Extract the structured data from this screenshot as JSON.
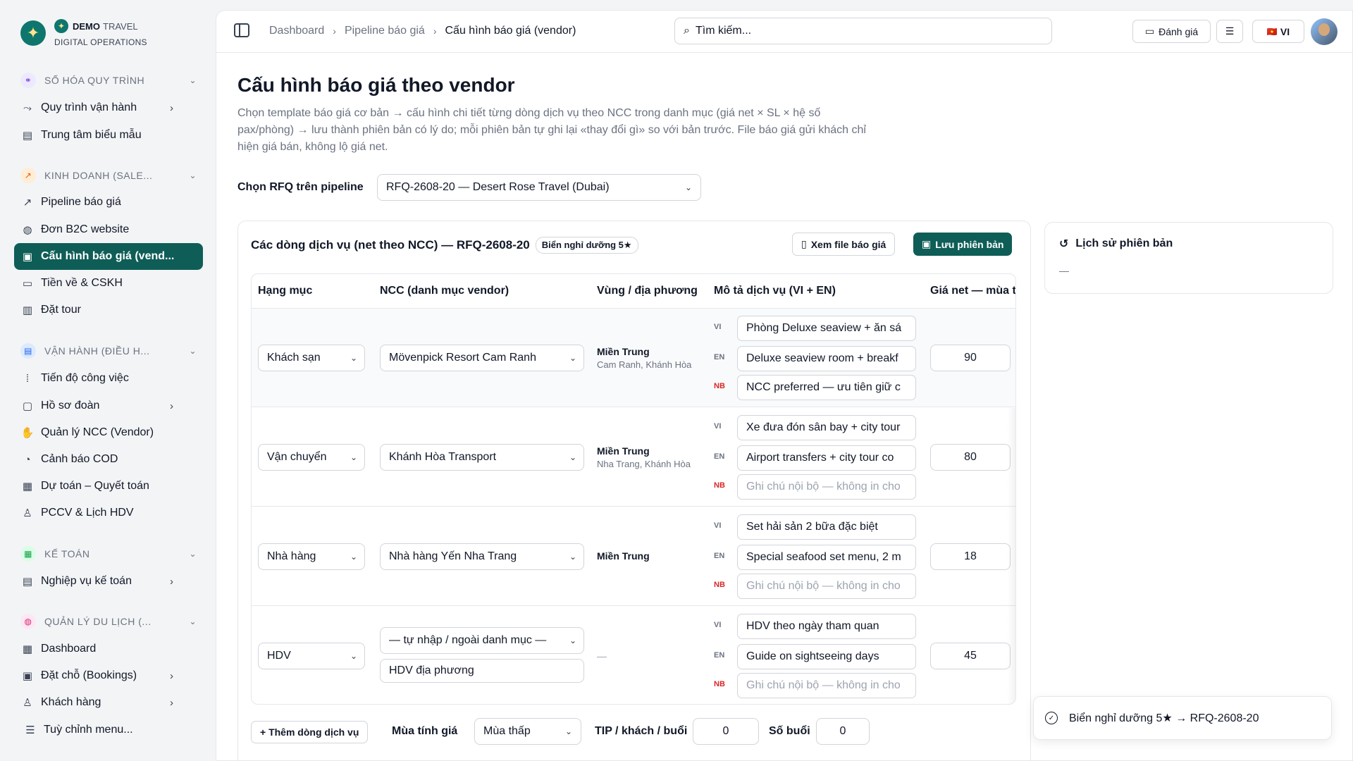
{
  "brand": {
    "logo_glyph": "✦",
    "name": "DEMO",
    "name_sub": "TRAVEL",
    "tagline": "DIGITAL OPERATIONS"
  },
  "sidebar": {
    "sections": [
      {
        "label": "SỐ HÓA QUY TRÌNH",
        "icon": "workflow-icon",
        "color": "#ede9fe",
        "items": [
          {
            "label": "Quy trình vận hành",
            "icon": "flow-icon",
            "arrow": true
          },
          {
            "label": "Trung tâm biểu mẫu",
            "icon": "document-icon",
            "arrow": false
          }
        ]
      },
      {
        "label": "KINH DOANH (SALE...",
        "icon": "trend-icon",
        "color": "#ffedd5",
        "items": [
          {
            "label": "Pipeline báo giá",
            "icon": "trend-up-icon",
            "arrow": false
          },
          {
            "label": "Đơn B2C website",
            "icon": "globe-icon",
            "arrow": false
          },
          {
            "label": "Cấu hình báo giá (vend...",
            "icon": "file-cog-icon",
            "arrow": false,
            "active": true
          },
          {
            "label": "Tiền về & CSKH",
            "icon": "money-icon",
            "arrow": false
          },
          {
            "label": "Đặt tour",
            "icon": "receipt-icon",
            "arrow": false
          }
        ]
      },
      {
        "label": "VẬN HÀNH (ĐIỀU H...",
        "icon": "ops-icon",
        "color": "#dbeafe",
        "items": [
          {
            "label": "Tiến độ công việc",
            "icon": "progress-icon",
            "arrow": false
          },
          {
            "label": "Hồ sơ đoàn",
            "icon": "folder-icon",
            "arrow": true
          },
          {
            "label": "Quản lý NCC (Vendor)",
            "icon": "handshake-icon",
            "arrow": false
          },
          {
            "label": "Cảnh báo COD",
            "icon": "alarm-icon",
            "arrow": false
          },
          {
            "label": "Dự toán – Quyết toán",
            "icon": "budget-icon",
            "arrow": false
          },
          {
            "label": "PCCV & Lịch HDV",
            "icon": "user-icon",
            "arrow": false
          }
        ]
      },
      {
        "label": "KẾ TOÁN",
        "icon": "calculator-icon",
        "color": "#dcfce7",
        "items": [
          {
            "label": "Nghiệp vụ kế toán",
            "icon": "ledger-icon",
            "arrow": true
          }
        ]
      },
      {
        "label": "QUẢN LÝ DU LỊCH (...",
        "icon": "globe-icon",
        "color": "#fce7f3",
        "items": [
          {
            "label": "Dashboard",
            "icon": "grid-icon",
            "arrow": false
          },
          {
            "label": "Đặt chỗ (Bookings)",
            "icon": "calendar-icon",
            "arrow": true
          },
          {
            "label": "Khách hàng",
            "icon": "users-icon",
            "arrow": true
          }
        ]
      }
    ],
    "customize_label": "Tuỳ chỉnh menu..."
  },
  "topbar": {
    "breadcrumbs": [
      "Dashboard",
      "Pipeline báo giá",
      "Cấu hình báo giá (vendor)"
    ],
    "search_placeholder": "Tìm kiếm...",
    "feedback_label": "Đánh giá",
    "language_label": "VI",
    "language_flag": "🇻🇳"
  },
  "page": {
    "title": "Cấu hình báo giá theo vendor",
    "description": "Chọn template báo giá cơ bản → cấu hình chi tiết từng dòng dịch vụ theo NCC trong danh mục (giá net × SL × hệ số pax/phòng) → lưu thành phiên bản có lý do; mỗi phiên bản tự ghi lại «thay đổi gì» so với bản trước. File báo giá gửi khách chỉ hiện giá bán, không lộ giá net.",
    "rfq_label": "Chọn RFQ trên pipeline",
    "rfq_value": "RFQ-2608-20 — Desert Rose Travel (Dubai)"
  },
  "card": {
    "title": "Các dòng dịch vụ (net theo NCC) — RFQ-2608-20",
    "badge": "Biển nghỉ dưỡng 5★",
    "view_file_label": "Xem file báo giá",
    "save_label": "Lưu phiên bản",
    "columns": [
      "Hạng mục",
      "NCC (danh mục vendor)",
      "Vùng / địa phương",
      "Mô tả dịch vụ (VI + EN)",
      "Giá net — mùa t"
    ],
    "lang_tags": [
      "VI",
      "EN",
      "NB"
    ],
    "rows": [
      {
        "category": "Khách sạn",
        "vendor": "Mövenpick Resort Cam Ranh",
        "region": "Miền Trung",
        "region_sub": "Cam Ranh, Khánh Hòa",
        "desc_vi": "Phòng Deluxe seaview + ăn sá",
        "desc_en": "Deluxe seaview room + breakf",
        "desc_nb": "NCC preferred — ưu tiên giữ c",
        "nb_placeholder": false,
        "price": "90"
      },
      {
        "category": "Vận chuyển",
        "vendor": "Khánh Hòa Transport",
        "region": "Miền Trung",
        "region_sub": "Nha Trang, Khánh Hòa",
        "desc_vi": "Xe đưa đón sân bay + city tour",
        "desc_en": "Airport transfers + city tour co",
        "desc_nb": "Ghi chú nội bộ — không in cho",
        "nb_placeholder": true,
        "price": "80"
      },
      {
        "category": "Nhà hàng",
        "vendor": "Nhà hàng Yến Nha Trang",
        "region": "Miền Trung",
        "region_sub": "",
        "desc_vi": "Set hải sản 2 bữa đặc biệt",
        "desc_en": "Special seafood set menu, 2 m",
        "desc_nb": "Ghi chú nội bộ — không in cho",
        "nb_placeholder": true,
        "price": "18"
      },
      {
        "category": "HDV",
        "vendor": "— tự nhập / ngoài danh mục —",
        "vendor_custom": "HDV địa phương",
        "region": "—",
        "region_sub": "",
        "desc_vi": "HDV theo ngày tham quan",
        "desc_en": "Guide on sightseeing days",
        "desc_nb": "Ghi chú nội bộ — không in cho",
        "nb_placeholder": true,
        "price": "45"
      }
    ],
    "footer": {
      "add_row_label": "+ Thêm dòng dịch vụ",
      "season_label": "Mùa tính giá",
      "season_value": "Mùa thấp",
      "tip_label": "TIP / khách / buổi",
      "tip_value": "0",
      "sessions_label": "Số buổi",
      "sessions_value": "0"
    }
  },
  "history": {
    "title": "Lịch sử phiên bản",
    "empty": "—"
  },
  "toast": {
    "message": "Biển nghỉ dưỡng 5★ → RFQ-2608-20"
  }
}
